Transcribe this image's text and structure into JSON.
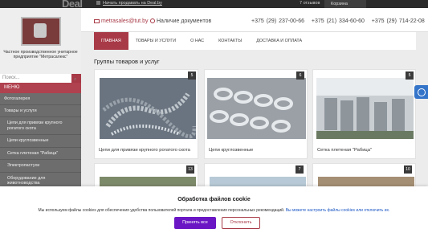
{
  "topbar": {
    "logo": "Deal",
    "sell_link": "Начать продавать на Deal.by",
    "reviews": "7 отзывов",
    "cart": "Корзина"
  },
  "company": {
    "name": "Частное производственное унитарное предприятие \"Метрасалекс\""
  },
  "search": {
    "placeholder": "Поиск...",
    "button_icon": "search-icon"
  },
  "sidebar": {
    "menu_title": "МЕНЮ",
    "items": [
      {
        "label": "Фотогалерея",
        "level": 1
      },
      {
        "label": "Товары и услуги",
        "level": 1
      },
      {
        "label": "Цепи для привязи крупного рогатого скота",
        "level": 2
      },
      {
        "label": "Цепи круглозвенные",
        "level": 2
      },
      {
        "label": "Сетка плетеная \"Рабица\"",
        "level": 2
      },
      {
        "label": "Электропастухи",
        "level": 2
      },
      {
        "label": "Оборудование для животноводства",
        "level": 2
      }
    ]
  },
  "header": {
    "email": "metrasales@tut.by",
    "docs": "Наличие документов",
    "phones": [
      "+375 (29) 237-00-66",
      "+375 (21) 334-60-60",
      "+375 (29) 714-22-08"
    ]
  },
  "nav": [
    "ГЛАВНАЯ",
    "ТОВАРЫ И УСЛУГИ",
    "О НАС",
    "КОНТАКТЫ",
    "ДОСТАВКА И ОПЛАТА"
  ],
  "page_title": "Группы товаров и услуг",
  "cards": [
    {
      "badge": "5",
      "caption": "Цепи для привязи крупного рогатого скота",
      "image": "chains-pile-photo"
    },
    {
      "badge": "6",
      "caption": "Цепи круглозвенные",
      "image": "steel-chain-photo"
    },
    {
      "badge": "5",
      "caption": "Сетка плетеная \"Рабица\"",
      "image": "mesh-rolls-photo"
    },
    {
      "badge": "13",
      "caption": "",
      "image": "partial-photo-1"
    },
    {
      "badge": "7",
      "caption": "",
      "image": "partial-photo-2"
    },
    {
      "badge": "10",
      "caption": "",
      "image": "partial-photo-3"
    }
  ],
  "cookies": {
    "title": "Обработка файлов cookie",
    "text": "Мы используем файлы cookies для обеспечения удобства пользователей портала и предоставления персональных рекомендаций.",
    "link": "Вы можете настроить файлы cookies или отключить их.",
    "accept": "Принять все",
    "decline": "Отклонить"
  },
  "colors": {
    "brand": "#a83a47",
    "sidebar": "#6d6d6d",
    "accept": "#6a16c4",
    "a11y": "#3474c9"
  }
}
